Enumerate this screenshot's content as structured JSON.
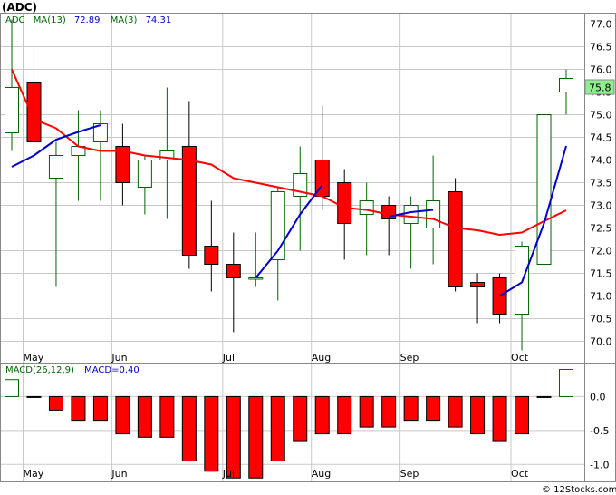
{
  "colors": {
    "up_fill": "#ffffff",
    "up_border": "#006400",
    "down_fill": "#ff0000",
    "down_border": "#000000",
    "ma13": "#ff0000",
    "ma3": "#0000cc",
    "grid": "#c8c8c8",
    "price_tag_bg": "#90ee90",
    "panel_border": "#888888",
    "legend_label": "#006400",
    "legend_value": "#0000cc"
  },
  "chart_data": [
    {
      "type": "candlestick",
      "title": "(ADC)",
      "legend": {
        "ticker": "ADC",
        "ma13_label": "MA(13)",
        "ma13_value": "72.89",
        "ma3_label": "MA(3)",
        "ma3_value": "74.31"
      },
      "last_price_tag": "75.8",
      "y_ticks": [
        "77.0",
        "76.5",
        "76.0",
        "75.5",
        "75.0",
        "74.5",
        "74.0",
        "73.5",
        "73.0",
        "72.5",
        "72.0",
        "71.5",
        "71.0",
        "70.5",
        "70.0"
      ],
      "y_tick_values": [
        77.0,
        76.5,
        76.0,
        75.5,
        75.0,
        74.5,
        74.0,
        73.5,
        73.0,
        72.5,
        72.0,
        71.5,
        71.0,
        70.5,
        70.0
      ],
      "ylim": [
        69.53,
        77.25
      ],
      "x_labels": [
        {
          "label": "May",
          "index": 1
        },
        {
          "label": "Jun",
          "index": 5
        },
        {
          "label": "Jul",
          "index": 10
        },
        {
          "label": "Aug",
          "index": 14
        },
        {
          "label": "Sep",
          "index": 18
        },
        {
          "label": "Oct",
          "index": 23
        }
      ],
      "candles": [
        {
          "o": 74.6,
          "h": 77.1,
          "l": 74.2,
          "c": 75.6
        },
        {
          "o": 75.7,
          "h": 76.5,
          "l": 73.7,
          "c": 74.4
        },
        {
          "o": 73.6,
          "h": 74.4,
          "l": 71.2,
          "c": 74.1
        },
        {
          "o": 74.1,
          "h": 75.1,
          "l": 73.1,
          "c": 74.3
        },
        {
          "o": 74.4,
          "h": 75.1,
          "l": 73.1,
          "c": 74.8
        },
        {
          "o": 74.3,
          "h": 74.8,
          "l": 73.0,
          "c": 73.5
        },
        {
          "o": 73.4,
          "h": 74.1,
          "l": 72.8,
          "c": 74.0
        },
        {
          "o": 74.0,
          "h": 75.6,
          "l": 72.7,
          "c": 74.2
        },
        {
          "o": 74.3,
          "h": 75.3,
          "l": 71.6,
          "c": 71.9
        },
        {
          "o": 72.1,
          "h": 73.1,
          "l": 71.1,
          "c": 71.7
        },
        {
          "o": 71.7,
          "h": 72.4,
          "l": 70.2,
          "c": 71.4
        },
        {
          "o": 71.4,
          "h": 72.4,
          "l": 71.2,
          "c": 71.4
        },
        {
          "o": 71.8,
          "h": 73.4,
          "l": 70.9,
          "c": 73.3
        },
        {
          "o": 73.2,
          "h": 74.3,
          "l": 72.0,
          "c": 73.7
        },
        {
          "o": 74.0,
          "h": 75.2,
          "l": 72.9,
          "c": 73.2
        },
        {
          "o": 73.5,
          "h": 73.8,
          "l": 71.8,
          "c": 72.6
        },
        {
          "o": 72.8,
          "h": 73.5,
          "l": 71.9,
          "c": 73.1
        },
        {
          "o": 73.0,
          "h": 73.2,
          "l": 71.9,
          "c": 72.7
        },
        {
          "o": 72.6,
          "h": 73.2,
          "l": 71.6,
          "c": 73.0
        },
        {
          "o": 72.5,
          "h": 74.1,
          "l": 71.7,
          "c": 73.1
        },
        {
          "o": 73.3,
          "h": 73.6,
          "l": 71.1,
          "c": 71.2
        },
        {
          "o": 71.3,
          "h": 71.5,
          "l": 70.4,
          "c": 71.2
        },
        {
          "o": 71.4,
          "h": 71.5,
          "l": 70.4,
          "c": 70.6
        },
        {
          "o": 70.6,
          "h": 72.2,
          "l": 69.8,
          "c": 72.1
        },
        {
          "o": 71.7,
          "h": 75.1,
          "l": 71.6,
          "c": 75.0
        },
        {
          "o": 75.5,
          "h": 76.0,
          "l": 75.0,
          "c": 75.8
        }
      ],
      "ma13": [
        76.0,
        74.9,
        74.7,
        74.3,
        74.2,
        74.2,
        74.1,
        74.05,
        74.0,
        73.9,
        73.6,
        73.5,
        73.4,
        73.3,
        73.2,
        72.95,
        72.9,
        72.8,
        72.75,
        72.7,
        72.5,
        72.45,
        72.35,
        72.4,
        72.65,
        72.89
      ],
      "ma3": [
        73.85,
        74.1,
        74.45,
        74.62,
        74.77,
        null,
        null,
        null,
        null,
        null,
        null,
        71.4,
        72.0,
        72.8,
        73.45,
        null,
        null,
        72.75,
        72.85,
        72.9,
        null,
        null,
        71.0,
        71.3,
        72.6,
        74.31
      ]
    },
    {
      "type": "bar",
      "title": "MACD",
      "legend": {
        "label": "MACD(26,12,9)",
        "value_label": "MACD=0.40"
      },
      "y_ticks": [
        "0.0",
        "-0.5",
        "-1.0"
      ],
      "y_tick_values": [
        0.0,
        -0.5,
        -1.0
      ],
      "ylim": [
        -1.25,
        0.5
      ],
      "values": [
        0.25,
        0.0,
        -0.2,
        -0.35,
        -0.35,
        -0.55,
        -0.6,
        -0.6,
        -0.95,
        -1.1,
        -1.2,
        -1.2,
        -0.95,
        -0.65,
        -0.55,
        -0.55,
        -0.45,
        -0.45,
        -0.35,
        -0.35,
        -0.45,
        -0.55,
        -0.65,
        -0.55,
        0.0,
        0.4
      ]
    }
  ],
  "watermark": "© 12Stocks.com"
}
